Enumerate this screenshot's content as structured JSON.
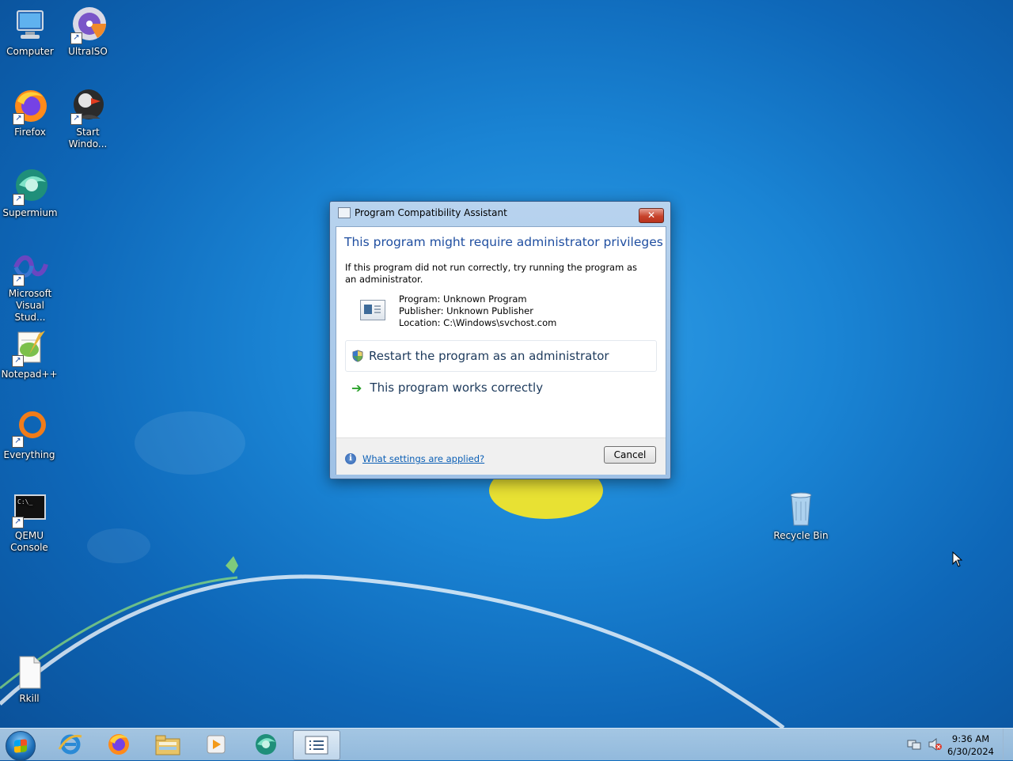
{
  "desktop": {
    "icons": [
      {
        "label": "Computer",
        "icon": "computer-icon"
      },
      {
        "label": "UltraISO",
        "icon": "ultraiso-icon"
      },
      {
        "label": "Firefox",
        "icon": "firefox-icon"
      },
      {
        "label": "Start Windo...",
        "icon": "start-windows-icon"
      },
      {
        "label": "Supermium",
        "icon": "supermium-icon"
      },
      {
        "label": "Microsoft Visual Stud...",
        "icon": "visual-studio-icon"
      },
      {
        "label": "Notepad++",
        "icon": "notepad-plus-icon"
      },
      {
        "label": "Everything",
        "icon": "everything-icon"
      },
      {
        "label": "QEMU Console",
        "icon": "qemu-console-icon"
      },
      {
        "label": "Recycle Bin",
        "icon": "recycle-bin-icon"
      },
      {
        "label": "Rkill",
        "icon": "rkill-icon"
      }
    ]
  },
  "dialog": {
    "title": "Program Compatibility Assistant",
    "close_label": "✕",
    "main_instruction": "This program might require administrator privileges",
    "description": "If this program did not run correctly, try running the program as an administrator.",
    "program_line": "Program: Unknown Program",
    "publisher_line": "Publisher: Unknown Publisher",
    "location_line": "Location: C:\\Windows\\svchost.com",
    "command_restart": "Restart the program as an administrator",
    "command_works": "This program works correctly",
    "cancel_label": "Cancel",
    "footer_link": "What settings are applied?"
  },
  "taskbar": {
    "pinned": [
      "internet-explorer-icon",
      "firefox-icon",
      "windows-explorer-icon",
      "media-player-icon",
      "supermium-icon",
      "program-compatibility-assistant-icon"
    ],
    "time": "9:36 AM",
    "date": "6/30/2024"
  }
}
